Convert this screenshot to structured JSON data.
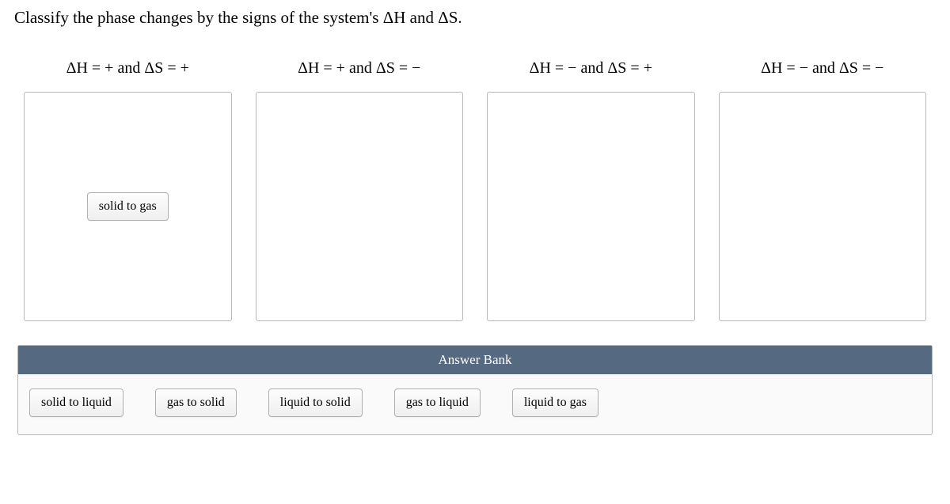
{
  "question": "Classify the phase changes by the signs of the system's ΔH and ΔS.",
  "categories": [
    {
      "label_html": "ΔH = + and ΔS = +",
      "placed_items": [
        "solid to gas"
      ]
    },
    {
      "label_html": "ΔH = + and ΔS = −",
      "placed_items": []
    },
    {
      "label_html": "ΔH = − and ΔS = +",
      "placed_items": []
    },
    {
      "label_html": "ΔH = − and ΔS = −",
      "placed_items": []
    }
  ],
  "answer_bank": {
    "title": "Answer Bank",
    "items": [
      "solid to liquid",
      "gas to solid",
      "liquid to solid",
      "gas to liquid",
      "liquid to gas"
    ]
  }
}
